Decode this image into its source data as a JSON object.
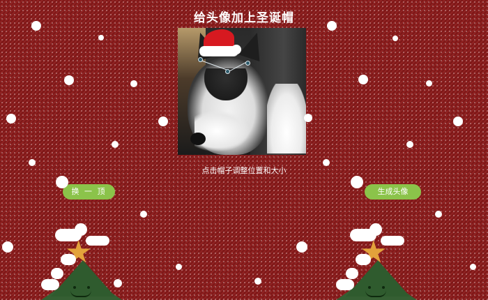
{
  "page": {
    "title": "给头像加上圣诞帽",
    "hint": "点击帽子调整位置和大小"
  },
  "buttons": {
    "change_hat": "换 一 顶",
    "generate_avatar": "生成头像"
  },
  "colors": {
    "background": "#8c1b1b",
    "button": "#8bc34a",
    "hat_red": "#d71920"
  },
  "icons": {
    "left_tree": "christmas-tree",
    "right_tree": "christmas-tree",
    "hat": "santa-hat"
  }
}
